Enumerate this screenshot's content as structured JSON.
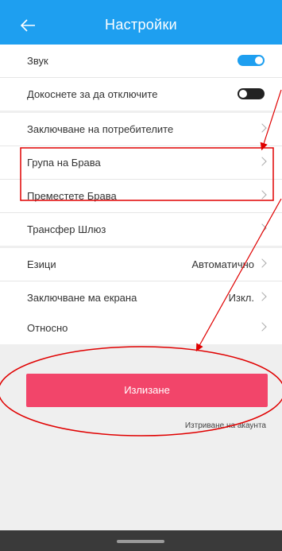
{
  "header": {
    "title": "Настройки"
  },
  "sections": {
    "s1": [
      {
        "label": "Звук",
        "toggle": "on"
      },
      {
        "label": "Докоснете за да отключите",
        "toggle": "off"
      }
    ],
    "s2": [
      {
        "label": "Заключване на потребителите"
      },
      {
        "label": "Група на Брава"
      },
      {
        "label": "Преместете Брава"
      },
      {
        "label": "Трансфер Шлюз"
      }
    ],
    "s3": [
      {
        "label": "Езици",
        "value": "Автоматично"
      },
      {
        "label": "Заключване ма екрана",
        "value": "Изкл."
      }
    ],
    "s4": [
      {
        "label": "Относно"
      }
    ]
  },
  "actions": {
    "logout_label": "Излизане",
    "delete_account_label": "Изтриване на акаунта"
  },
  "colors": {
    "header": "#1e9ff0",
    "logout_button": "#f2456a",
    "annotation": "#e00000"
  }
}
